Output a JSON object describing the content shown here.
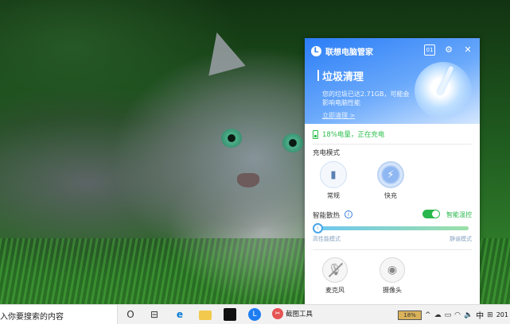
{
  "taskbar": {
    "search_text": "入你要搜索的内容",
    "cortana_glyph": "O",
    "taskview_glyph": "⊟",
    "edge_glyph": "e",
    "snip_app_label": "截图工具",
    "tray_battery": "18%",
    "tray_chevron": "^",
    "tray_lang": "中",
    "tray_ime": "⊞",
    "tray_time": "201"
  },
  "panel": {
    "app_title": "联想电脑管家",
    "header": {
      "clean_title": "垃圾清理",
      "clean_desc": "您的垃圾已达2.71GB，可能会影响电脑性能",
      "clean_link": "立即清理 >"
    },
    "battery_status": "18%电量，正在充电",
    "charge_mode_label": "充电模式",
    "modes": [
      {
        "label": "常规",
        "icon": "battery-icon",
        "active": false
      },
      {
        "label": "快充",
        "icon": "lightning-icon",
        "active": true
      }
    ],
    "smart_cooling_label": "智能散热",
    "smart_temp_label": "智能温控",
    "slider_left_label": "高性能模式",
    "slider_right_label": "静谧模式",
    "slider_level": 0.0,
    "tools": [
      {
        "label": "麦克风",
        "icon": "microphone-disabled-icon"
      },
      {
        "label": "摄像头",
        "icon": "camera-icon"
      }
    ]
  },
  "colors": {
    "header_blue": "#2a7df7",
    "charging_green": "#2bbf4d",
    "toggle_green": "#27b74a"
  }
}
